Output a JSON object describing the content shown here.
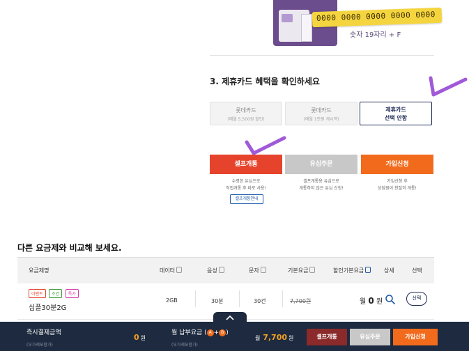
{
  "sim": {
    "number_strip": "0000 0000 0000 0000 0000",
    "digits_note": "숫자 19자리 + F"
  },
  "affiliate": {
    "title": "3. 제휴카드 혜택을 확인하세요",
    "options": [
      {
        "label": "롯데카드",
        "sub": "(매월 5,500원 할인)"
      },
      {
        "label": "롯데카드",
        "sub": "(매월 1만원 캐시백)"
      },
      {
        "label": "제휴카드",
        "sub": "선택 안함"
      }
    ]
  },
  "actions": {
    "self_open": {
      "label": "셀프개통",
      "desc1": "수령한 유심으로",
      "desc2": "직접개통 후 바로 사용!"
    },
    "paid_order": {
      "label": "유심주문",
      "desc1": "셀프개통용 유심으로",
      "desc2": "개통하지 않은 유심 신청!"
    },
    "join": {
      "label": "가입신청",
      "desc1": "가입신청 후",
      "desc2": "상담원이 친절히 개통!"
    },
    "guide_label": "셀프개통안내"
  },
  "compare": {
    "title": "다른 요금제와 비교해 보세요.",
    "headers": {
      "plan": "요금제명",
      "data": "데이터",
      "voice": "음성",
      "text": "문자",
      "base": "기본요금",
      "discount": "할인기본요금",
      "detail": "상세",
      "select": "선택"
    },
    "rows": [
      {
        "tags": [
          "이벤트",
          "조건",
          "특가"
        ],
        "name": "심플30분2G",
        "data": "2GB",
        "voice": "30분",
        "text": "30건",
        "base": "7,700원",
        "discount_prefix": "월",
        "discount_value": "0",
        "discount_unit": "원",
        "select_label": "선택"
      }
    ]
  },
  "bottom": {
    "instant_label": "즉시결제금액",
    "instant_sub": "(부가세포함가)",
    "instant_value": "0",
    "instant_unit": "원",
    "monthly_label": "월 납부요금",
    "monthly_badges": [
      "A",
      "B"
    ],
    "monthly_sub": "(부가세포함가)",
    "monthly_prefix": "월",
    "monthly_value": "7,700",
    "monthly_unit": "원",
    "btn_self": "셀프개통",
    "btn_paid": "유심주문",
    "btn_join": "가입신청"
  },
  "colors": {
    "self": "#e6432c",
    "paid": "#c8c8c8",
    "join": "#f26b1d",
    "navy": "#1d2a3f",
    "check": "#a05ad8"
  }
}
